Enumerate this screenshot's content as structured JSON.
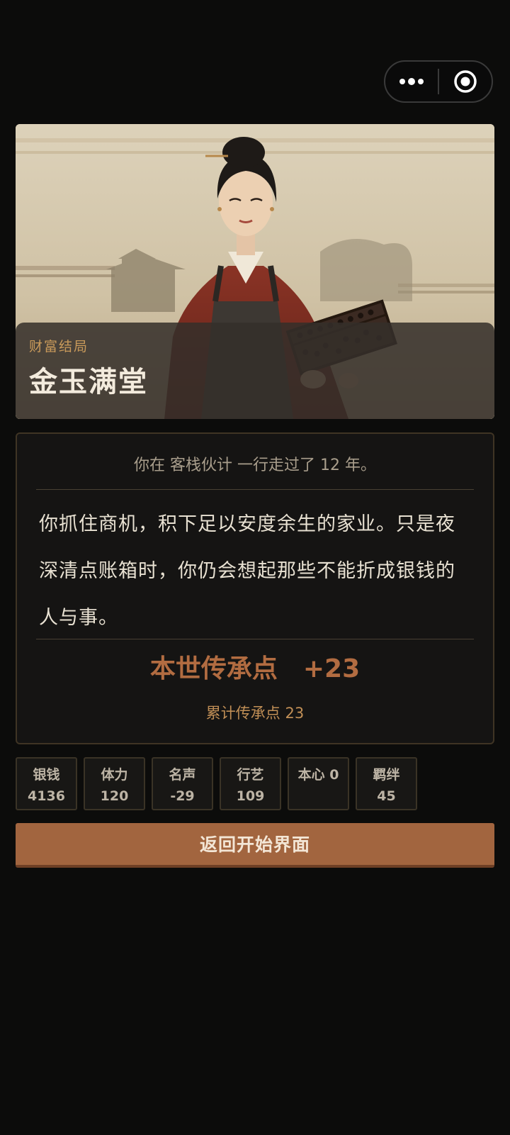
{
  "capsule": {
    "more_icon": "more-dots-icon",
    "close_icon": "target-circle-icon"
  },
  "hero": {
    "ending_type": "财富结局",
    "ending_title": "金玉满堂"
  },
  "story": {
    "summary": "你在 客栈伙计 一行走过了 12 年。",
    "text": "你抓住商机，积下足以安度余生的家业。只是夜深清点账箱时，你仍会想起那些不能折成银钱的人与事。",
    "legacy_label": "本世传承点",
    "legacy_value": "+23",
    "legacy_total": "累计传承点 23"
  },
  "stats": [
    {
      "label": "银钱",
      "value": "4136"
    },
    {
      "label": "体力",
      "value": "120"
    },
    {
      "label": "名声",
      "value": "-29"
    },
    {
      "label": "行艺",
      "value": "109"
    },
    {
      "label": "本心 0",
      "value": ""
    },
    {
      "label": "羁绊",
      "value": "45"
    }
  ],
  "actions": {
    "return_label": "返回开始界面"
  },
  "colors": {
    "background": "#0c0c0b",
    "accent": "#a2653f",
    "legacy_text": "#b26c41",
    "ending_type": "#c99a5a"
  }
}
